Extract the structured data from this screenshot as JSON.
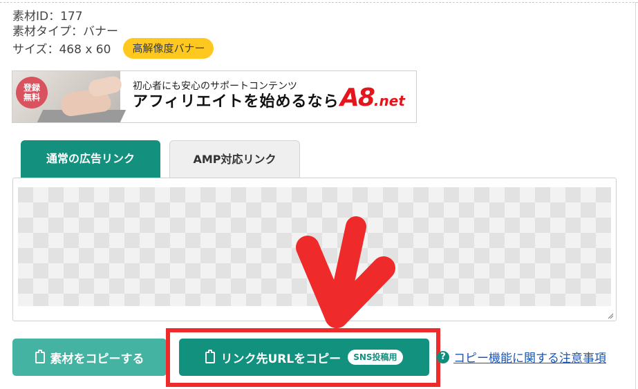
{
  "material": {
    "id_line": "素材ID：177",
    "type_line": "素材タイプ：バナー",
    "size_line": "サイズ：468 x 60",
    "badge": "高解像度バナー"
  },
  "banner": {
    "free_label_1": "登録",
    "free_label_2": "無料",
    "sub_text": "初心者にも安心のサポートコンテンツ",
    "main_text": "アフィリエイトを始めるなら",
    "logo_big": "A8",
    "logo_net": ".net"
  },
  "tabs": [
    {
      "label": "通常の広告リンク",
      "active": true
    },
    {
      "label": "AMP対応リンク",
      "active": false
    }
  ],
  "buttons": {
    "copy_material": "素材をコピーする",
    "copy_url": "リンク先URLをコピー",
    "sns_badge": "SNS投稿用"
  },
  "help": {
    "icon": "?",
    "link_text": "コピー機能に関する注意事項"
  },
  "colors": {
    "accent": "#13917f",
    "accent_light": "#45b3a2",
    "badge_yellow": "#ffc81e",
    "highlight_red": "#ee2a2a",
    "link_blue": "#1a56b8"
  }
}
